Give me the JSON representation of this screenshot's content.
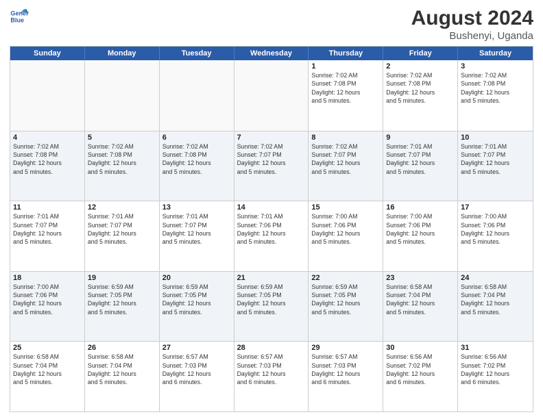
{
  "logo": {
    "line1": "General",
    "line2": "Blue"
  },
  "title": "August 2024",
  "location": "Bushenyi, Uganda",
  "weekdays": [
    "Sunday",
    "Monday",
    "Tuesday",
    "Wednesday",
    "Thursday",
    "Friday",
    "Saturday"
  ],
  "weeks": [
    [
      {
        "day": "",
        "info": "",
        "empty": true
      },
      {
        "day": "",
        "info": "",
        "empty": true
      },
      {
        "day": "",
        "info": "",
        "empty": true
      },
      {
        "day": "",
        "info": "",
        "empty": true
      },
      {
        "day": "1",
        "info": "Sunrise: 7:02 AM\nSunset: 7:08 PM\nDaylight: 12 hours\nand 5 minutes.",
        "empty": false
      },
      {
        "day": "2",
        "info": "Sunrise: 7:02 AM\nSunset: 7:08 PM\nDaylight: 12 hours\nand 5 minutes.",
        "empty": false
      },
      {
        "day": "3",
        "info": "Sunrise: 7:02 AM\nSunset: 7:08 PM\nDaylight: 12 hours\nand 5 minutes.",
        "empty": false
      }
    ],
    [
      {
        "day": "4",
        "info": "Sunrise: 7:02 AM\nSunset: 7:08 PM\nDaylight: 12 hours\nand 5 minutes.",
        "empty": false
      },
      {
        "day": "5",
        "info": "Sunrise: 7:02 AM\nSunset: 7:08 PM\nDaylight: 12 hours\nand 5 minutes.",
        "empty": false
      },
      {
        "day": "6",
        "info": "Sunrise: 7:02 AM\nSunset: 7:08 PM\nDaylight: 12 hours\nand 5 minutes.",
        "empty": false
      },
      {
        "day": "7",
        "info": "Sunrise: 7:02 AM\nSunset: 7:07 PM\nDaylight: 12 hours\nand 5 minutes.",
        "empty": false
      },
      {
        "day": "8",
        "info": "Sunrise: 7:02 AM\nSunset: 7:07 PM\nDaylight: 12 hours\nand 5 minutes.",
        "empty": false
      },
      {
        "day": "9",
        "info": "Sunrise: 7:01 AM\nSunset: 7:07 PM\nDaylight: 12 hours\nand 5 minutes.",
        "empty": false
      },
      {
        "day": "10",
        "info": "Sunrise: 7:01 AM\nSunset: 7:07 PM\nDaylight: 12 hours\nand 5 minutes.",
        "empty": false
      }
    ],
    [
      {
        "day": "11",
        "info": "Sunrise: 7:01 AM\nSunset: 7:07 PM\nDaylight: 12 hours\nand 5 minutes.",
        "empty": false
      },
      {
        "day": "12",
        "info": "Sunrise: 7:01 AM\nSunset: 7:07 PM\nDaylight: 12 hours\nand 5 minutes.",
        "empty": false
      },
      {
        "day": "13",
        "info": "Sunrise: 7:01 AM\nSunset: 7:07 PM\nDaylight: 12 hours\nand 5 minutes.",
        "empty": false
      },
      {
        "day": "14",
        "info": "Sunrise: 7:01 AM\nSunset: 7:06 PM\nDaylight: 12 hours\nand 5 minutes.",
        "empty": false
      },
      {
        "day": "15",
        "info": "Sunrise: 7:00 AM\nSunset: 7:06 PM\nDaylight: 12 hours\nand 5 minutes.",
        "empty": false
      },
      {
        "day": "16",
        "info": "Sunrise: 7:00 AM\nSunset: 7:06 PM\nDaylight: 12 hours\nand 5 minutes.",
        "empty": false
      },
      {
        "day": "17",
        "info": "Sunrise: 7:00 AM\nSunset: 7:06 PM\nDaylight: 12 hours\nand 5 minutes.",
        "empty": false
      }
    ],
    [
      {
        "day": "18",
        "info": "Sunrise: 7:00 AM\nSunset: 7:06 PM\nDaylight: 12 hours\nand 5 minutes.",
        "empty": false
      },
      {
        "day": "19",
        "info": "Sunrise: 6:59 AM\nSunset: 7:05 PM\nDaylight: 12 hours\nand 5 minutes.",
        "empty": false
      },
      {
        "day": "20",
        "info": "Sunrise: 6:59 AM\nSunset: 7:05 PM\nDaylight: 12 hours\nand 5 minutes.",
        "empty": false
      },
      {
        "day": "21",
        "info": "Sunrise: 6:59 AM\nSunset: 7:05 PM\nDaylight: 12 hours\nand 5 minutes.",
        "empty": false
      },
      {
        "day": "22",
        "info": "Sunrise: 6:59 AM\nSunset: 7:05 PM\nDaylight: 12 hours\nand 5 minutes.",
        "empty": false
      },
      {
        "day": "23",
        "info": "Sunrise: 6:58 AM\nSunset: 7:04 PM\nDaylight: 12 hours\nand 5 minutes.",
        "empty": false
      },
      {
        "day": "24",
        "info": "Sunrise: 6:58 AM\nSunset: 7:04 PM\nDaylight: 12 hours\nand 5 minutes.",
        "empty": false
      }
    ],
    [
      {
        "day": "25",
        "info": "Sunrise: 6:58 AM\nSunset: 7:04 PM\nDaylight: 12 hours\nand 5 minutes.",
        "empty": false
      },
      {
        "day": "26",
        "info": "Sunrise: 6:58 AM\nSunset: 7:04 PM\nDaylight: 12 hours\nand 5 minutes.",
        "empty": false
      },
      {
        "day": "27",
        "info": "Sunrise: 6:57 AM\nSunset: 7:03 PM\nDaylight: 12 hours\nand 6 minutes.",
        "empty": false
      },
      {
        "day": "28",
        "info": "Sunrise: 6:57 AM\nSunset: 7:03 PM\nDaylight: 12 hours\nand 6 minutes.",
        "empty": false
      },
      {
        "day": "29",
        "info": "Sunrise: 6:57 AM\nSunset: 7:03 PM\nDaylight: 12 hours\nand 6 minutes.",
        "empty": false
      },
      {
        "day": "30",
        "info": "Sunrise: 6:56 AM\nSunset: 7:02 PM\nDaylight: 12 hours\nand 6 minutes.",
        "empty": false
      },
      {
        "day": "31",
        "info": "Sunrise: 6:56 AM\nSunset: 7:02 PM\nDaylight: 12 hours\nand 6 minutes.",
        "empty": false
      }
    ]
  ]
}
